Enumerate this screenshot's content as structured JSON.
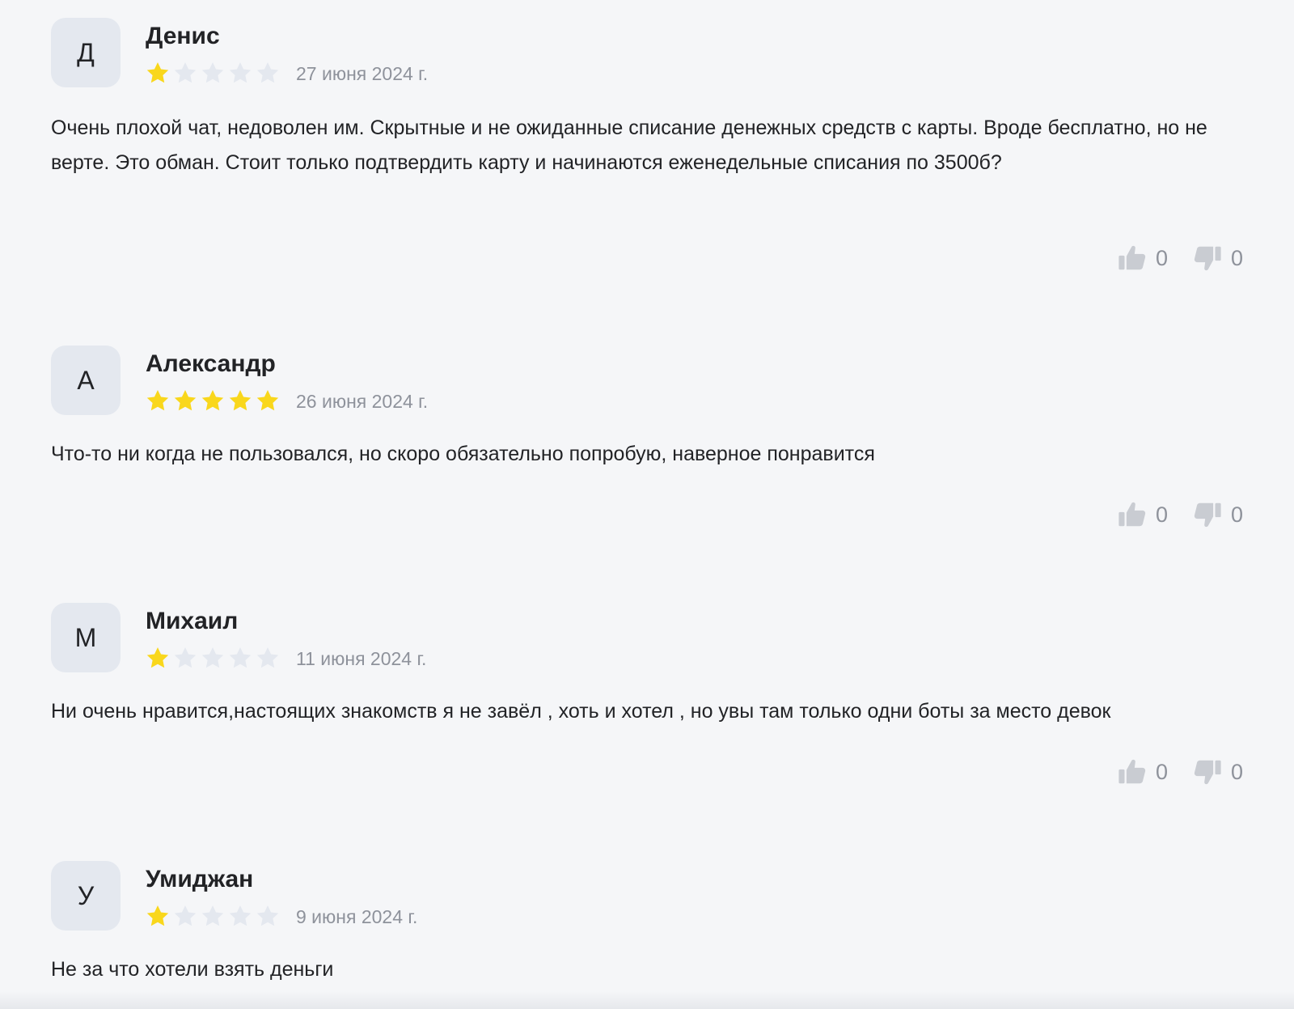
{
  "colors": {
    "background": "#f5f6f8",
    "avatar_background": "#e4e8ef",
    "star_filled": "#f9d71c",
    "star_empty": "#e4e8ef",
    "thumb_icon": "#c9ccd2",
    "muted_text": "#8e929b"
  },
  "icons": {
    "star": "star-icon",
    "like": "thumbs-up-icon",
    "dislike": "thumbs-down-icon"
  },
  "reviews": [
    {
      "avatar_letter": "Д",
      "author": "Денис",
      "rating": 1,
      "max_rating": 5,
      "date": "27 июня 2024 г.",
      "text": "Очень плохой чат, недоволен им. Скрытные и не ожиданные списание денежных средств с карты. Вроде бесплатно, но не верте. Это обман. Стоит только подтвердить карту и начинаются еженедельные списания по 3500б?",
      "likes": "0",
      "dislikes": "0"
    },
    {
      "avatar_letter": "А",
      "author": "Александр",
      "rating": 5,
      "max_rating": 5,
      "date": "26 июня 2024 г.",
      "text": "Что-то ни когда не пользовался, но скоро обязательно попробую, наверное понравится",
      "likes": "0",
      "dislikes": "0"
    },
    {
      "avatar_letter": "М",
      "author": "Михаил",
      "rating": 1,
      "max_rating": 5,
      "date": "11 июня 2024 г.",
      "text": "Ни очень нравится,настоящих знакомств я не завёл , хоть и хотел , но увы там только одни боты за место девок",
      "likes": "0",
      "dislikes": "0"
    },
    {
      "avatar_letter": "У",
      "author": "Умиджан",
      "rating": 1,
      "max_rating": 5,
      "date": "9 июня 2024 г.",
      "text": "Не за что хотели взять деньги"
    }
  ]
}
